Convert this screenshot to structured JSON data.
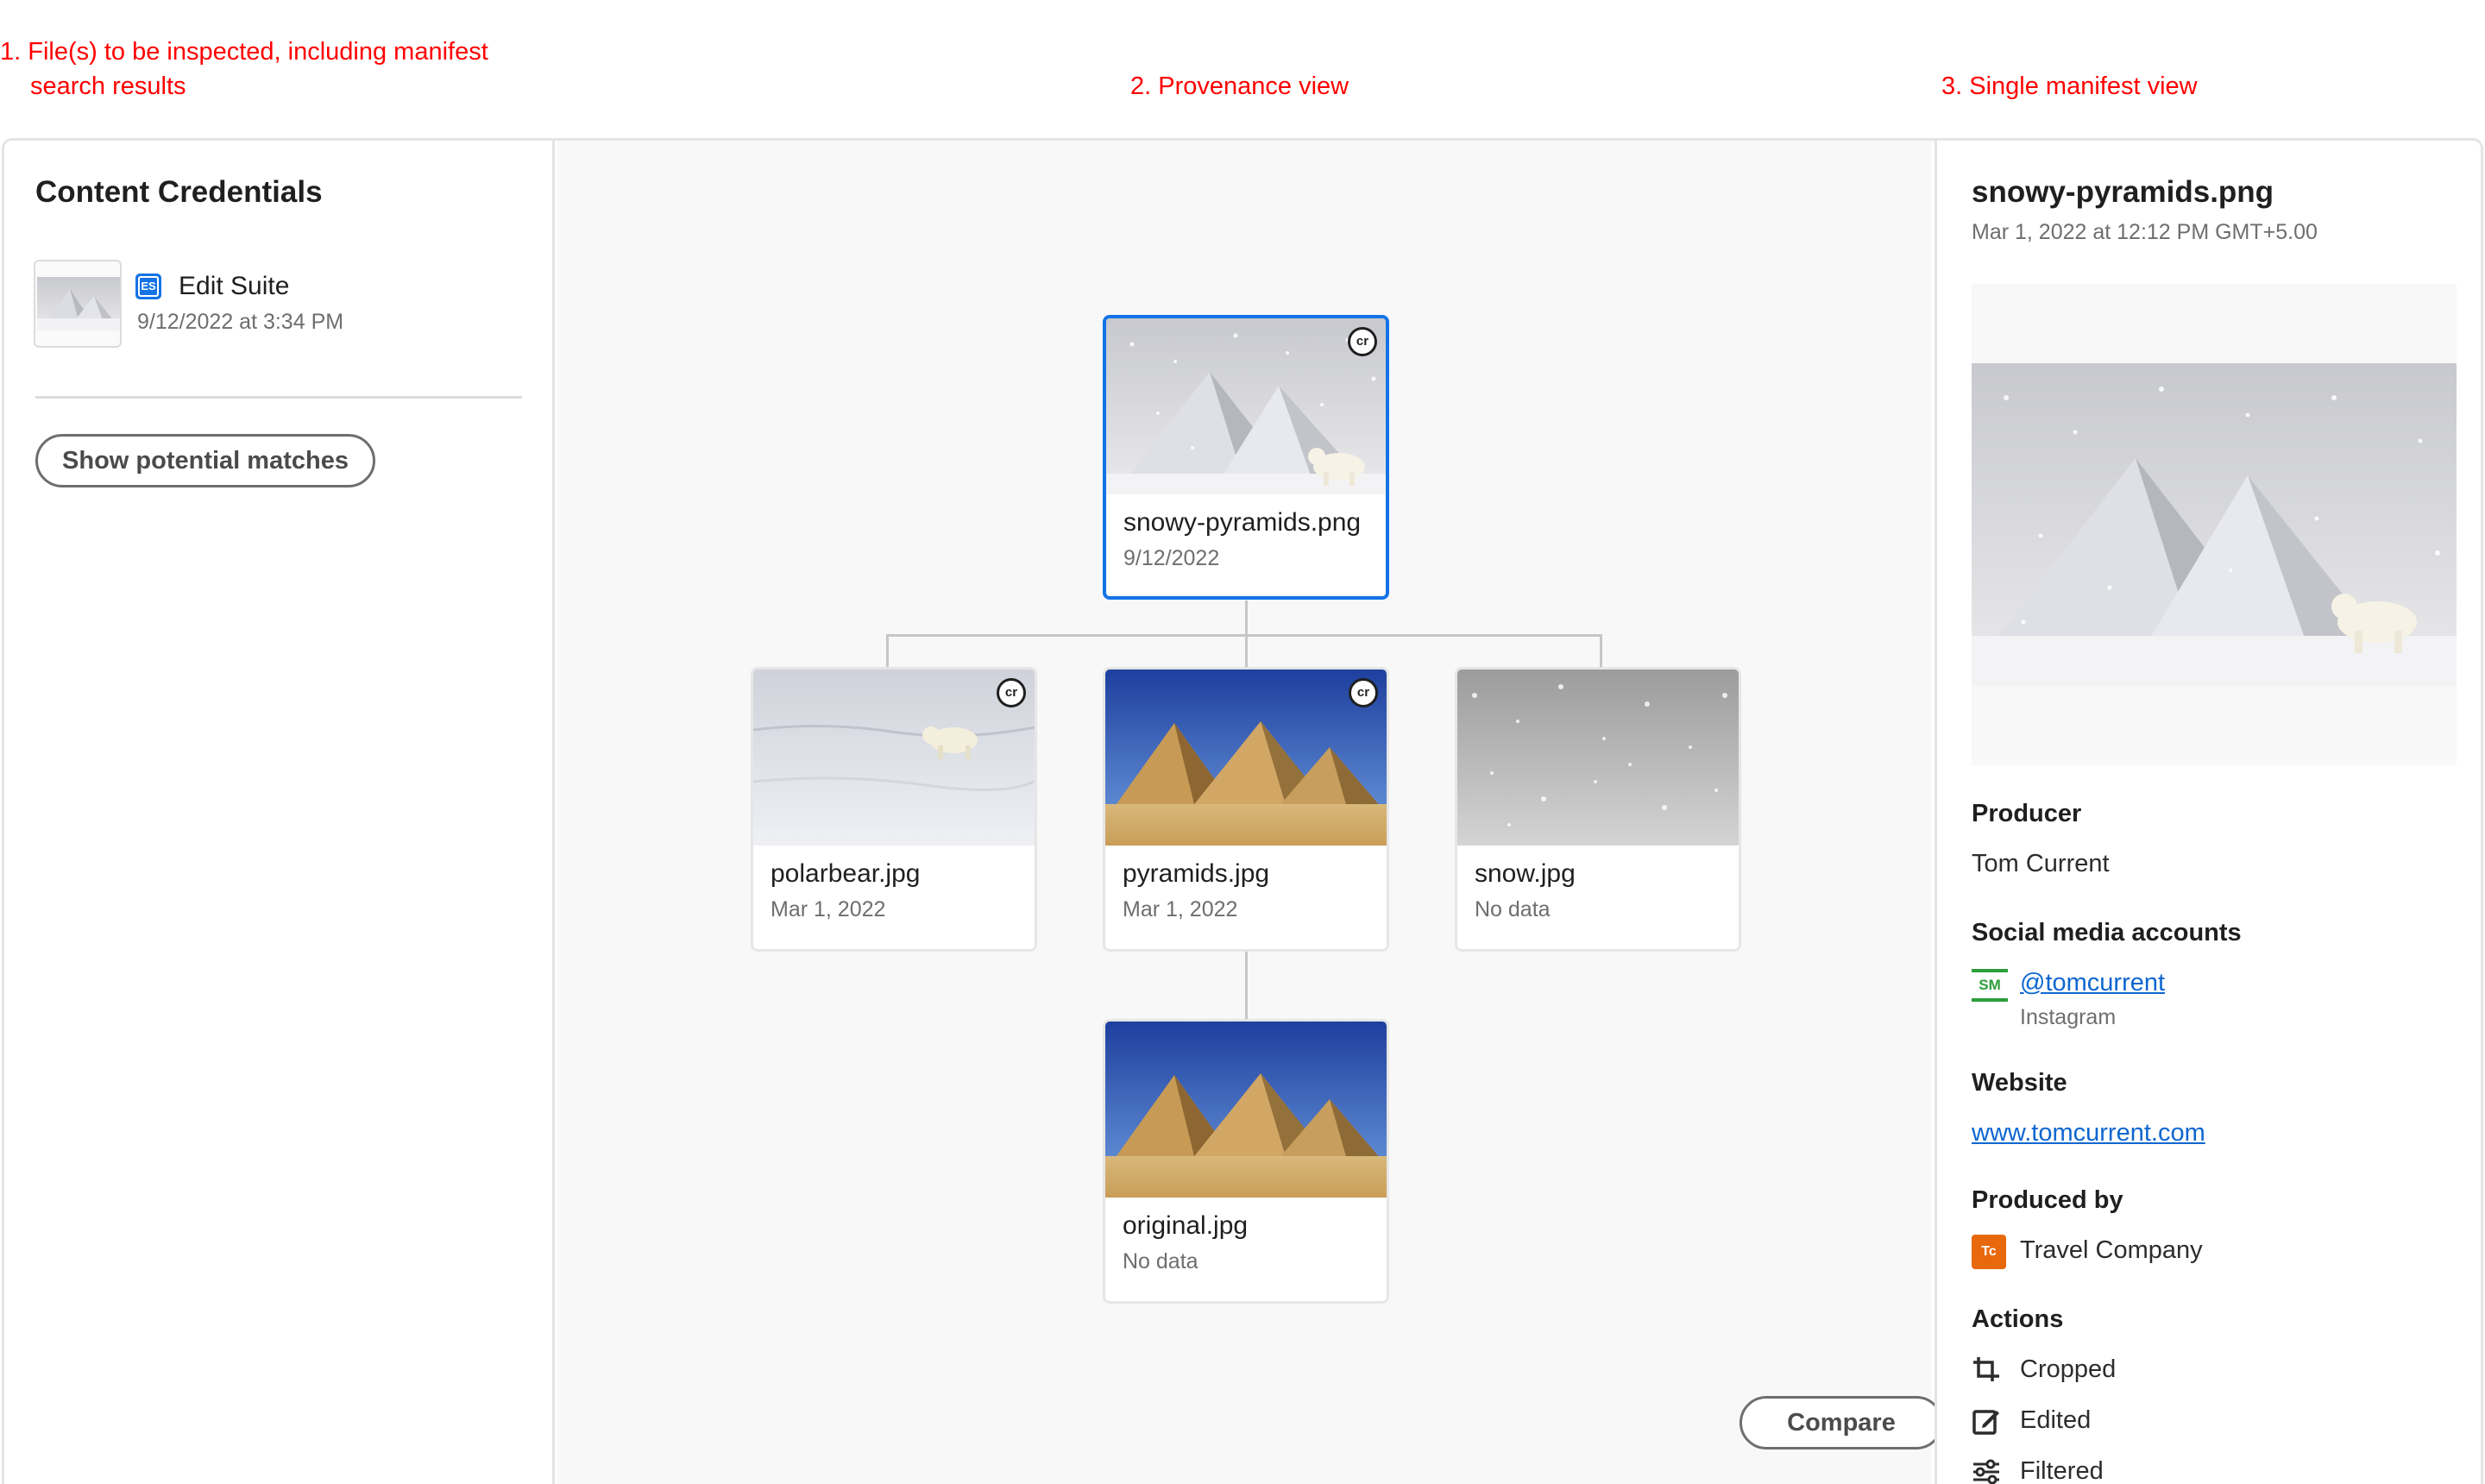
{
  "annotations": {
    "files_line1": "1. File(s) to be inspected, including manifest",
    "files_line2": "search results",
    "provenance": "2. Provenance view",
    "single": "3. Single manifest view"
  },
  "left_panel": {
    "title": "Content Credentials",
    "item": {
      "app": "Edit Suite",
      "app_icon": "ES",
      "date": "9/12/2022 at 3:34 PM"
    },
    "show_matches_label": "Show potential matches"
  },
  "tree": {
    "root": {
      "name": "snowy-pyramids.png",
      "date": "9/12/2022",
      "has_cr": true
    },
    "children": [
      {
        "name": "polarbear.jpg",
        "date": "Mar 1, 2022",
        "has_cr": true
      },
      {
        "name": "pyramids.jpg",
        "date": "Mar 1, 2022",
        "has_cr": true
      },
      {
        "name": "snow.jpg",
        "date": "No data",
        "has_cr": false
      }
    ],
    "grandchild": {
      "name": "original.jpg",
      "date": "No data",
      "has_cr": false
    },
    "cr_badge": "cr",
    "compare_label": "Compare"
  },
  "manifest": {
    "title": "snowy-pyramids.png",
    "date": "Mar 1, 2022 at 12:12 PM GMT+5.00",
    "producer_label": "Producer",
    "producer": "Tom Current",
    "social_label": "Social media accounts",
    "social_handle": "@tomcurrent",
    "social_icon": "SM",
    "social_platform": "Instagram",
    "website_label": "Website",
    "website": "www.tomcurrent.com",
    "produced_by_label": "Produced by",
    "produced_by": "Travel Company",
    "produced_by_icon": "Tc",
    "actions_label": "Actions",
    "actions": [
      "Cropped",
      "Edited",
      "Filtered"
    ]
  }
}
